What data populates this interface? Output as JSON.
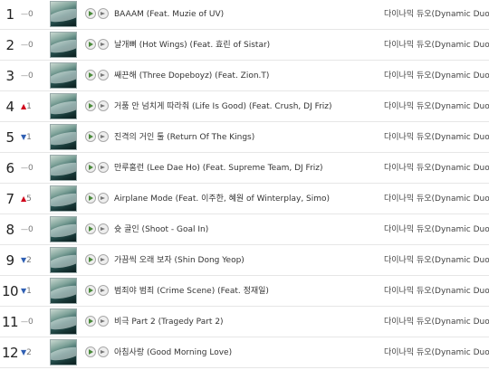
{
  "tracks": [
    {
      "rank": "1",
      "change_dir": "same",
      "change_value": "0",
      "title": "BAAAM (Feat. Muzie of UV)",
      "artist": "다이나믹 듀오(Dynamic Duo)"
    },
    {
      "rank": "2",
      "change_dir": "same",
      "change_value": "0",
      "title": "날개뼈 (Hot Wings) (Feat. 효린 of Sistar)",
      "artist": "다이나믹 듀오(Dynamic Duo)"
    },
    {
      "rank": "3",
      "change_dir": "same",
      "change_value": "0",
      "title": "쌔끈해 (Three Dopeboyz) (Feat. Zion.T)",
      "artist": "다이나믹 듀오(Dynamic Duo)"
    },
    {
      "rank": "4",
      "change_dir": "up",
      "change_value": "1",
      "title": "거품 안 넘치게 따라줘 (Life Is Good) (Feat. Crush, DJ Friz)",
      "artist": "다이나믹 듀오(Dynamic Duo)"
    },
    {
      "rank": "5",
      "change_dir": "down",
      "change_value": "1",
      "title": "진격의 거인 툴 (Return Of The Kings)",
      "artist": "다이나믹 듀오(Dynamic Duo)"
    },
    {
      "rank": "6",
      "change_dir": "same",
      "change_value": "0",
      "title": "만루홈런 (Lee Dae Ho) (Feat. Supreme Team, DJ Friz)",
      "artist": "다이나믹 듀오(Dynamic Duo)"
    },
    {
      "rank": "7",
      "change_dir": "up",
      "change_value": "5",
      "title": "Airplane Mode (Feat. 이주한, 혜원 of Winterplay, Simo)",
      "artist": "다이나믹 듀오(Dynamic Duo)"
    },
    {
      "rank": "8",
      "change_dir": "same",
      "change_value": "0",
      "title": "슛 골인 (Shoot - Goal In)",
      "artist": "다이나믹 듀오(Dynamic Duo)"
    },
    {
      "rank": "9",
      "change_dir": "down",
      "change_value": "2",
      "title": "가끔씩 오래 보자 (Shin Dong Yeop)",
      "artist": "다이나믹 듀오(Dynamic Duo)"
    },
    {
      "rank": "10",
      "change_dir": "down",
      "change_value": "1",
      "title": "범죄야 범죄 (Crime Scene) (Feat. 정재일)",
      "artist": "다이나믹 듀오(Dynamic Duo)"
    },
    {
      "rank": "11",
      "change_dir": "same",
      "change_value": "0",
      "title": "비극 Part 2 (Tragedy Part 2)",
      "artist": "다이나믹 듀오(Dynamic Duo)"
    },
    {
      "rank": "12",
      "change_dir": "down",
      "change_value": "2",
      "title": "아침사랑 (Good Morning Love)",
      "artist": "다이나믹 듀오(Dynamic Duo)"
    }
  ],
  "icons": {
    "play": "play-icon",
    "add": "add-icon",
    "up": "arrow-up-icon",
    "down": "arrow-down-icon",
    "same": "dash-icon"
  },
  "colors": {
    "up": "#d0021b",
    "down": "#2f5fb3",
    "same": "#888888"
  }
}
